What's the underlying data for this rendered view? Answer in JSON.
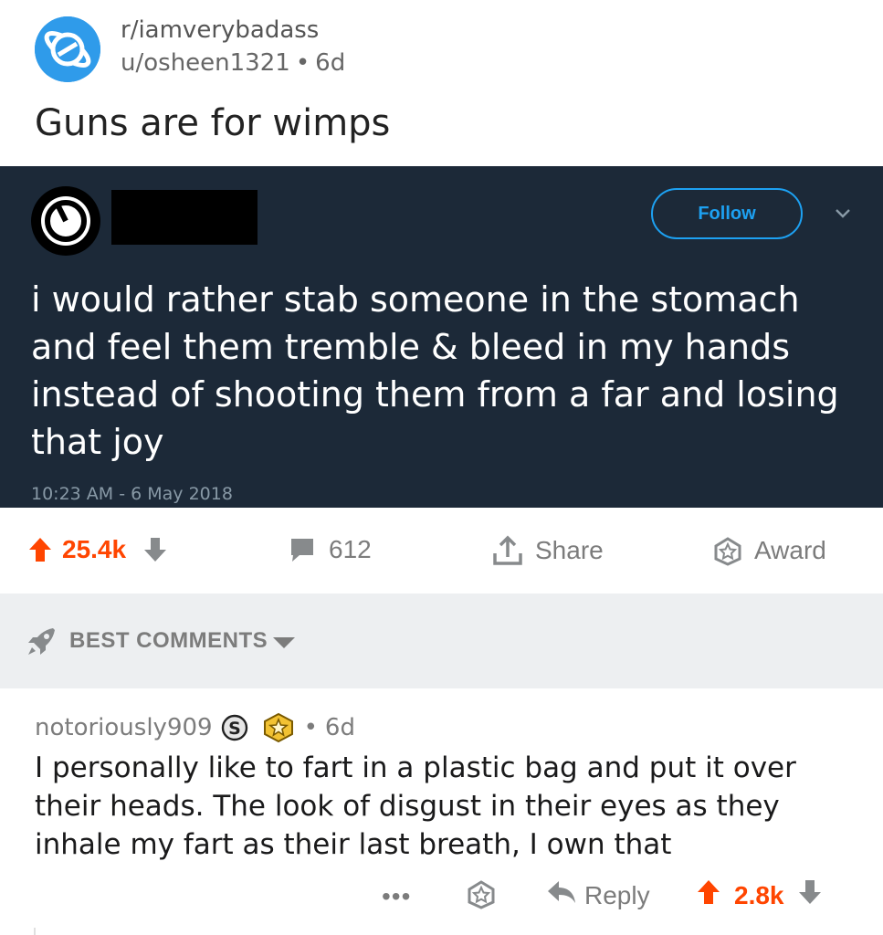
{
  "post": {
    "subreddit": "r/iamverybadass",
    "author": "u/osheen1321",
    "separator": "•",
    "age": "6d",
    "title": "Guns are for wimps"
  },
  "tweet": {
    "follow_label": "Follow",
    "text": "i would rather stab someone in the stomach and feel them tremble & bleed in my hands instead of shooting them from a far and losing that joy",
    "timestamp": "10:23 AM - 6 May 2018"
  },
  "actions": {
    "upvotes": "25.4k",
    "comments": "612",
    "share_label": "Share",
    "award_label": "Award"
  },
  "sort": {
    "label": "BEST COMMENTS"
  },
  "comment": {
    "author": "notoriously909",
    "separator": "•",
    "age": "6d",
    "body": "I personally like to fart in a plastic bag and put it over their heads. The look of disgust in their eyes as they inhale my fart as their last breath, I own that",
    "more_label": "•••",
    "reply_label": "Reply",
    "votes": "2.8k"
  },
  "colors": {
    "accent_upvote": "#ff4500",
    "twitter_blue": "#1da1f2",
    "tweet_bg": "#1c2938",
    "subreddit_icon": "#2f9bea"
  }
}
